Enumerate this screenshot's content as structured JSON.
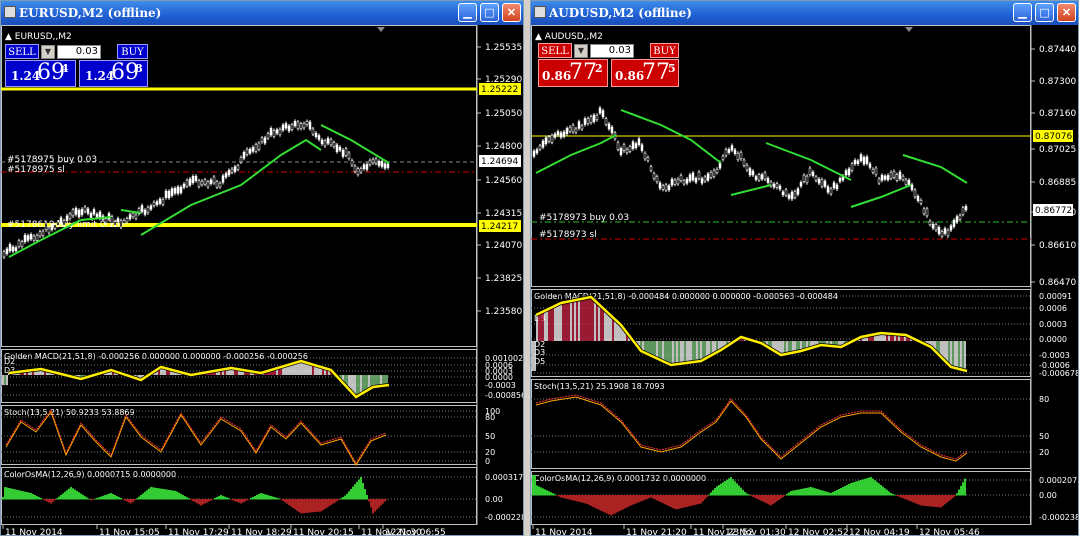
{
  "windows": [
    {
      "title": "EURUSD,M2 (offline)",
      "symbol_label": "EURUSD,,M2",
      "trade_panel": {
        "sell_label": "SELL",
        "buy_label": "BUY",
        "lot": "0.03",
        "bid": {
          "prefix": "1.24",
          "big": "69",
          "sup": "4"
        },
        "ask": {
          "prefix": "1.24",
          "big": "69",
          "sup": "8"
        },
        "color": "#0000cc"
      },
      "price_axis": [
        "1.25535",
        "1.25290",
        "1.25050",
        "1.24800",
        "1.24560",
        "1.24315",
        "1.24070",
        "1.23825",
        "1.23580"
      ],
      "price_tags": [
        "1.25222",
        "1.24694",
        "1.24217"
      ],
      "order_labels": [
        "#5178975 buy 0.03",
        "#5178975 sl",
        "#5178619 buy limit 0.10"
      ],
      "indicators": [
        {
          "label": "Golden MACD(21,51,8) -0.000256 0.000000 0.000000 -0.000256 -0.000256",
          "side_labels": [
            "D2",
            "D3"
          ],
          "axis": [
            "0.001002",
            "0.0006",
            "0.0003",
            "0.0000",
            "-0.0003",
            "-0.000856"
          ]
        },
        {
          "label": "Stoch(13,5,21) 50.9233 53.8869",
          "axis": [
            "100",
            "80",
            "50",
            "20",
            "0"
          ]
        },
        {
          "label": "ColorOsMA(12,26,9) 0.0000715 0.0000000",
          "axis": [
            "0.000317",
            "0.00",
            "-0.000228"
          ]
        }
      ],
      "time_axis": [
        "11 Nov 2014",
        "11 Nov 15:05",
        "11 Nov 17:29",
        "11 Nov 18:29",
        "11 Nov 20:15",
        "11 Nov 21:30",
        "12 Nov 06:55"
      ]
    },
    {
      "title": "AUDUSD,M2 (offline)",
      "symbol_label": "AUDUSD,,M2",
      "trade_panel": {
        "sell_label": "SELL",
        "buy_label": "BUY",
        "lot": "0.03",
        "bid": {
          "prefix": "0.86",
          "big": "77",
          "sup": "2"
        },
        "ask": {
          "prefix": "0.86",
          "big": "77",
          "sup": "5"
        },
        "color": "#cc0000"
      },
      "price_axis": [
        "0.87440",
        "0.87300",
        "0.87160",
        "0.87025",
        "0.86885",
        "0.86750",
        "0.86610",
        "0.86470"
      ],
      "price_tags": [
        "0.87076",
        "0.86772"
      ],
      "order_labels": [
        "#5178973 buy 0.03",
        "#5178973 sl"
      ],
      "indicators": [
        {
          "label": "Golden MACD(21,51,8) -0.000484 0.000000 0.000000 -0.000563 -0.000484",
          "side_labels": [
            "D3",
            "D2",
            "D3",
            "D5"
          ],
          "axis": [
            "0.00091",
            "0.0006",
            "0.0003",
            "0.0000",
            "-0.0003",
            "-0.0006",
            "-0.000678"
          ]
        },
        {
          "label": "Stoch(13,5,21) 25.1908 18.7093",
          "axis": [
            "80",
            "50",
            "20"
          ]
        },
        {
          "label": "ColorOsMA(12,26,9) 0.0001732 0.0000000",
          "axis": [
            "0.000207",
            "0.00",
            "-0.000238"
          ]
        }
      ],
      "time_axis": [
        "11 Nov 2014",
        "11 Nov 21:20",
        "11 Nov 23:52",
        "12 Nov 01:30",
        "12 Nov 02:52",
        "12 Nov 04:19",
        "12 Nov 05:46"
      ]
    }
  ]
}
